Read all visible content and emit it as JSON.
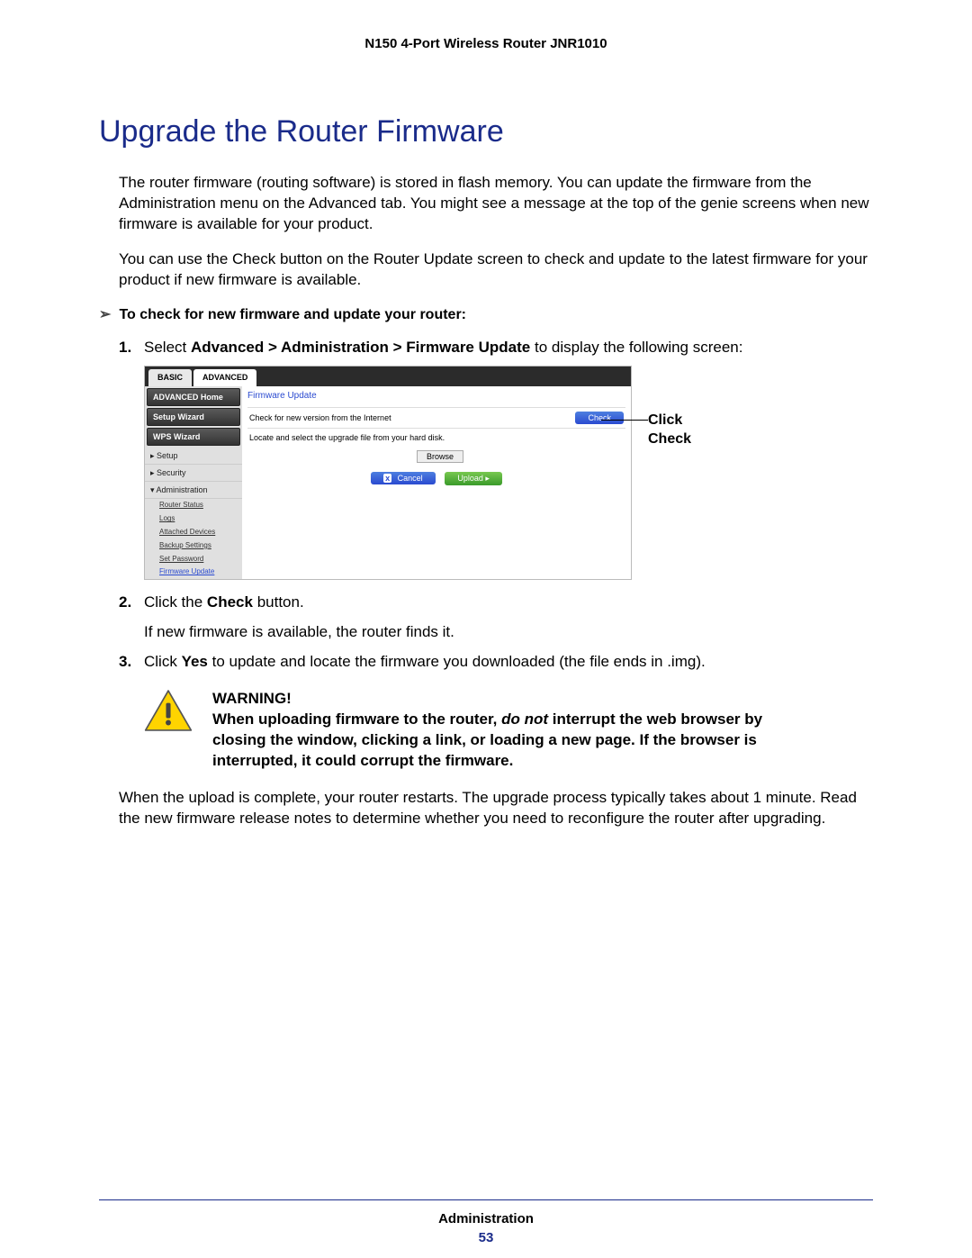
{
  "header": {
    "product": "N150 4-Port Wireless Router JNR1010"
  },
  "title": "Upgrade the Router Firmware",
  "para1": "The router firmware (routing software) is stored in flash memory. You can update the firmware from the Administration menu on the Advanced tab. You might see a message at the top of the genie screens when new firmware is available for your product.",
  "para2": "You can use the Check button on the Router Update screen to check and update to the latest firmware for your product if new firmware is available.",
  "procHead": "To check for new firmware and update your router:",
  "step1": {
    "pre": "Select ",
    "bold": "Advanced > Administration > Firmware Update",
    "post": " to display the following screen:"
  },
  "screenshot": {
    "tabs": {
      "basic": "BASIC",
      "advanced": "ADVANCED"
    },
    "sidebar": {
      "btn1": "ADVANCED Home",
      "btn2": "Setup Wizard",
      "btn3": "WPS Wizard",
      "link1": "Setup",
      "link2": "Security",
      "link3": "Administration",
      "sub": {
        "router_status": "Router Status",
        "logs": "Logs",
        "attached": "Attached Devices",
        "backup": "Backup Settings",
        "setpw": "Set Password",
        "fwupdate": "Firmware Update"
      }
    },
    "main": {
      "title": "Firmware Update",
      "line1": "Check for new version from the Internet",
      "check": "Check",
      "line2": "Locate and select the upgrade file from your hard disk.",
      "browse": "Browse",
      "cancel": "Cancel",
      "upload": "Upload   ▸"
    }
  },
  "callout": {
    "line1": "Click",
    "line2": "Check"
  },
  "step2": {
    "pre": "Click the ",
    "bold": "Check",
    "post": " button.",
    "after": "If new firmware is available, the router finds it."
  },
  "step3": {
    "pre": "Click ",
    "bold": "Yes",
    "post": " to update and locate the firmware you downloaded (the file ends in .img)."
  },
  "warning": {
    "head": "WARNING!",
    "body_pre": "When uploading firmware to the router, ",
    "body_donot": "do not",
    "body_post": " interrupt the web browser by closing the window, clicking a link, or loading a new page. If the browser is interrupted, it could corrupt the firmware."
  },
  "after": "When the upload is complete, your router restarts. The upgrade process typically takes about 1 minute. Read the new firmware release notes to determine whether you need to reconfigure the router after upgrading.",
  "footer": {
    "section": "Administration",
    "page": "53"
  }
}
